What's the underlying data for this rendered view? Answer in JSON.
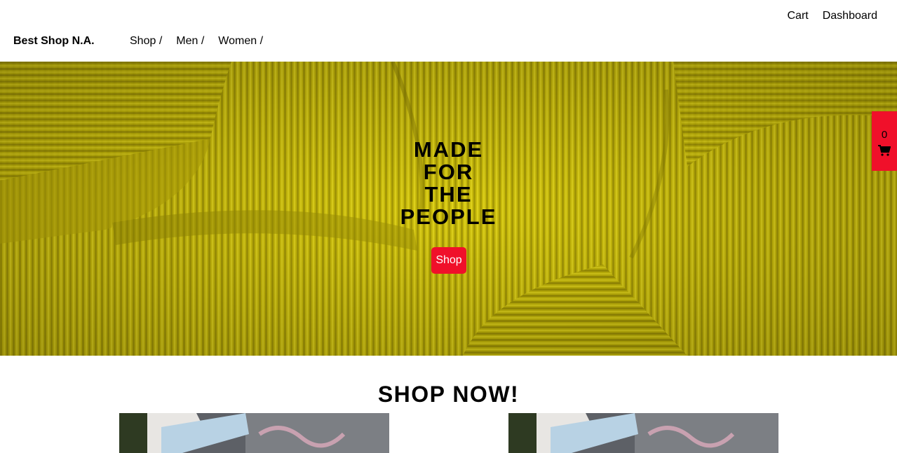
{
  "header": {
    "brand": "Best Shop N.A.",
    "top_links": {
      "cart": "Cart",
      "dashboard": "Dashboard"
    },
    "nav": [
      "Shop /",
      "Men /",
      "Women /"
    ]
  },
  "hero": {
    "title_lines": [
      "MADE",
      "FOR",
      "THE",
      "PEOPLE"
    ],
    "button": "Shop",
    "background_color": "#c9bd0a"
  },
  "cart_widget": {
    "count": "0",
    "icon": "shopping-cart-icon",
    "color": "#f0102a"
  },
  "section": {
    "title": "SHOP NOW!"
  },
  "accent_color": "#f0102a"
}
